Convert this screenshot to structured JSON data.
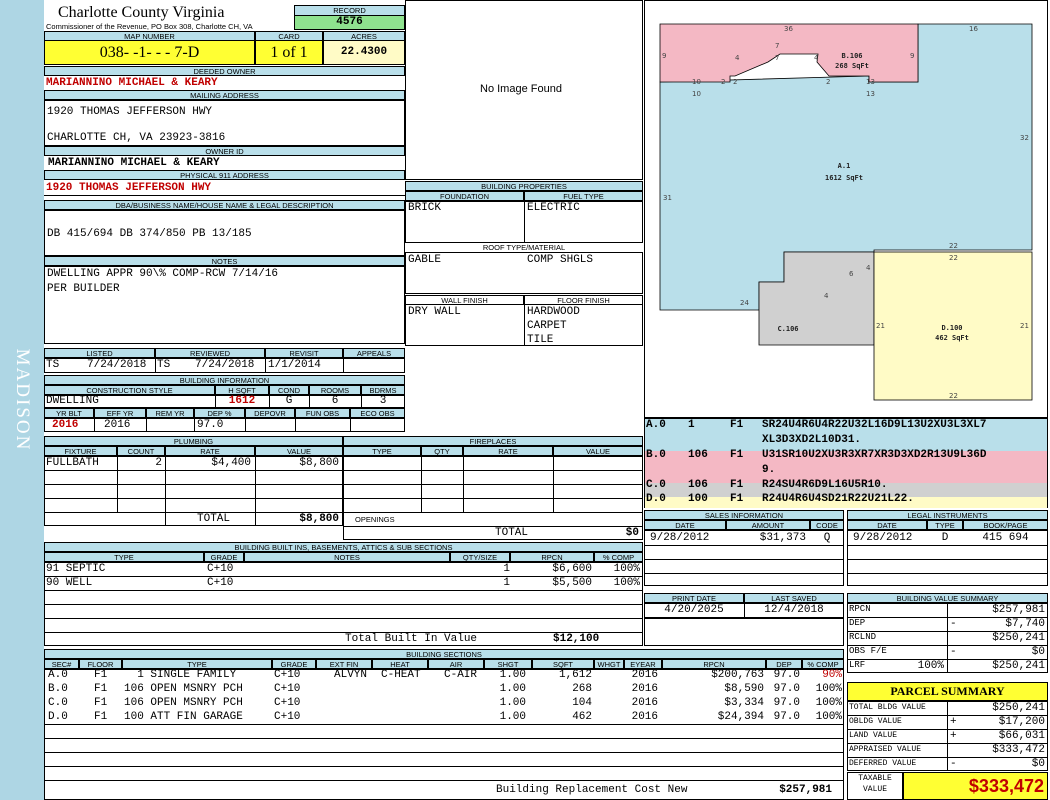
{
  "side_label": "MADISON",
  "header": {
    "county": "Charlotte County Virginia",
    "commissioner": "Commissioner of the Revenue, PO Box 308, Charlotte CH, VA",
    "record_label": "RECORD",
    "record": "4576"
  },
  "parcel": {
    "map_number_label": "MAP NUMBER",
    "map_number": "038- -1- - - 7-D",
    "card_label": "CARD",
    "card": "1 of 1",
    "acres_label": "ACRES",
    "acres": "22.4300"
  },
  "owner": {
    "deeded_label": "DEEDED OWNER",
    "deeded": "MARIANNINO MICHAEL & KEARY",
    "mailing_label": "MAILING ADDRESS",
    "mailing1": "1920 THOMAS JEFFERSON HWY",
    "mailing2": "CHARLOTTE CH, VA 23923-3816",
    "owner_id_label": "OWNER ID",
    "owner_id": "MARIANNINO MICHAEL & KEARY",
    "physical_label": "PHYSICAL 911 ADDRESS",
    "physical": "1920 THOMAS JEFFERSON HWY"
  },
  "legal": {
    "label": "DBA/BUSINESS NAME/HOUSE NAME & LEGAL DESCRIPTION",
    "text": "DB 415/694 DB 374/850 PB 13/185"
  },
  "notes": {
    "label": "NOTES",
    "line1": "DWELLING APPR 90\\% COMP-RCW 7/14/16",
    "line2": "PER BUILDER"
  },
  "photo": {
    "text": "No Image Found"
  },
  "building_props": {
    "label": "BUILDING PROPERTIES",
    "foundation_label": "FOUNDATION",
    "foundation": "BRICK",
    "fuel_label": "FUEL TYPE",
    "fuel": "ELECTRIC",
    "roof_label": "ROOF TYPE/MATERIAL",
    "roof_type": "GABLE",
    "roof_material": "COMP SHGLS",
    "wall_label": "WALL FINISH",
    "wall": "DRY WALL",
    "floor_label": "FLOOR FINISH",
    "floor1": "HARDWOOD",
    "floor2": "CARPET",
    "floor3": "TILE"
  },
  "dates": {
    "listed_label": "LISTED",
    "listed_by": "TS",
    "listed": "7/24/2018",
    "reviewed_label": "REVIEWED",
    "reviewed_by": "TS",
    "reviewed": "7/24/2018",
    "revisit_label": "REVISIT",
    "revisit": "1/1/2014",
    "appeals_label": "APPEALS",
    "appeals": ""
  },
  "bldg_info": {
    "label": "BUILDING INFORMATION",
    "style_label": "CONSTRUCTION STYLE",
    "style": "DWELLING",
    "hsqft_label": "H SQFT",
    "hsqft": "1612",
    "cond_label": "COND",
    "cond": "G",
    "rooms_label": "ROOMS",
    "rooms": "6",
    "bdrms_label": "BDRMS",
    "bdrms": "3",
    "yrblt_label": "YR BLT",
    "yrblt": "2016",
    "effyr_label": "EFF YR",
    "effyr": "2016",
    "remyr_label": "REM YR",
    "remyr": "",
    "dep_label": "DEP %",
    "dep": "97.0",
    "depovr_label": "DEPOVR",
    "funobs_label": "FUN OBS",
    "ecoobs_label": "ECO OBS"
  },
  "plumbing": {
    "label": "PLUMBING",
    "cols": [
      "FIXTURE",
      "COUNT",
      "RATE",
      "VALUE"
    ],
    "rows": [
      {
        "fixture": "FULLBATH",
        "count": "2",
        "rate": "$4,400",
        "value": "$8,800"
      }
    ],
    "total_label": "TOTAL",
    "total": "$8,800"
  },
  "fireplaces": {
    "label": "FIREPLACES",
    "cols": [
      "TYPE",
      "QTY",
      "RATE",
      "VALUE"
    ],
    "openings_label": "OPENINGS",
    "total_label": "TOTAL",
    "total": "$0"
  },
  "builtins": {
    "label": "BUILDING BUILT INS, BASEMENTS, ATTICS & SUB SECTIONS",
    "cols": [
      "TYPE",
      "GRADE",
      "NOTES",
      "QTY/SIZE",
      "RPCN",
      "% COMP"
    ],
    "rows": [
      {
        "type": "91 SEPTIC",
        "grade": "C+10",
        "qty": "1",
        "rpcn": "$6,600",
        "comp": "100%"
      },
      {
        "type": "90 WELL",
        "grade": "C+10",
        "qty": "1",
        "rpcn": "$5,500",
        "comp": "100%"
      }
    ],
    "total_label": "Total Built In Value",
    "total": "$12,100"
  },
  "sketch": {
    "labels": {
      "top36": "36",
      "top16": "16",
      "l9a": "9",
      "r9a": "9",
      "l31": "31",
      "r32": "32",
      "s10a": "10",
      "s10b": "10",
      "s13a": "13",
      "s13b": "13",
      "s7a": "7",
      "s7b": "7",
      "s4a": "4",
      "s4b": "4",
      "s2a": "2",
      "s2b": "2",
      "s2c": "2",
      "s22a": "22",
      "s22b": "22",
      "s22c": "22",
      "s4c": "4",
      "s6": "6",
      "s4d": "4",
      "s24": "24",
      "s21a": "21",
      "s21b": "21"
    },
    "areas": {
      "b_name": "B.106",
      "b_sqft": "268 SqFt",
      "a_name": "A.1",
      "a_sqft": "1612 SqFt",
      "c_name": "C.106",
      "d_name": "D.100",
      "d_sqft": "462 SqFt"
    }
  },
  "vectors": [
    {
      "id": "A.0",
      "code": "1",
      "fl": "F1",
      "v": "SR24U4R6U4R22U32L16D9L13U2XU3L3XL7",
      "v2": "XL3D3XD2L10D31.",
      "bg": "#b9dfea"
    },
    {
      "id": "B.0",
      "code": "106",
      "fl": "F1",
      "v": "U31SR10U2XU3R3XR7XR3D3XD2R13U9L36D",
      "v2": "9.",
      "bg": "#f4b8c4"
    },
    {
      "id": "C.0",
      "code": "106",
      "fl": "F1",
      "v": "R24SU4R6D9L16U5R10.",
      "v2": "",
      "bg": "#d0d0d0"
    },
    {
      "id": "D.0",
      "code": "100",
      "fl": "F1",
      "v": "R24U4R6U4SD21R22U21L22.",
      "v2": "",
      "bg": "#fffbc6"
    }
  ],
  "sales": {
    "label": "SALES INFORMATION",
    "cols": [
      "DATE",
      "AMOUNT",
      "CODE"
    ],
    "date": "9/28/2012",
    "amount": "$31,373",
    "code": "Q"
  },
  "legal_instruments": {
    "label": "LEGAL INSTRUMENTS",
    "cols": [
      "DATE",
      "TYPE",
      "BOOK/PAGE"
    ],
    "date": "9/28/2012",
    "type": "D",
    "bookpage": "415 694"
  },
  "print": {
    "print_label": "PRINT DATE",
    "print_date": "4/20/2025",
    "saved_label": "LAST SAVED",
    "saved": "12/4/2018"
  },
  "value_summary": {
    "label": "BUILDING VALUE SUMMARY",
    "rpcn_l": "RPCN",
    "rpcn": "$257,981",
    "dep_l": "DEP",
    "dep_s": "-",
    "dep": "$7,740",
    "rclnd_l": "RCLND",
    "rclnd": "$250,241",
    "obs_l": "OBS F/E",
    "obs_s": "-",
    "obs": "$0",
    "lrf_l": "LRF",
    "lrf_pct": "100%",
    "lrf": "$250,241"
  },
  "parcel_summary": {
    "label": "PARCEL SUMMARY",
    "tb_l": "TOTAL BLDG VALUE",
    "tb": "$250,241",
    "ob_l": "OBLDG VALUE",
    "ob_s": "+",
    "ob": "$17,200",
    "land_l": "LAND VALUE",
    "land_s": "+",
    "land": "$66,031",
    "appr_l": "APPRAISED VALUE",
    "appr": "$333,472",
    "def_l": "DEFERRED VALUE",
    "def_s": "-",
    "def": "$0",
    "tax_l1": "TAXABLE",
    "tax_l2": "VALUE",
    "tax": "$333,472"
  },
  "sections": {
    "label": "BUILDING SECTIONS",
    "cols": [
      "SEC#",
      "FLOOR",
      "TYPE",
      "GRADE",
      "EXT FIN",
      "HEAT",
      "AIR",
      "SHGT",
      "SQFT",
      "WHGT",
      "EYEAR",
      "RPCN",
      "DEP",
      "% COMP"
    ],
    "rows": [
      {
        "sec": "A.0",
        "fl": "F1",
        "type": "  1 SINGLE FAMILY",
        "grade": "C+10",
        "ext": "ALVYN",
        "heat": "C-HEAT",
        "air": "C-AIR",
        "shgt": "1.00",
        "sqft": "1,612",
        "eyear": "2016",
        "rpcn": "$200,763",
        "dep": "97.0",
        "comp": "90%"
      },
      {
        "sec": "B.0",
        "fl": "F1",
        "type": "106 OPEN MSNRY PCH",
        "grade": "C+10",
        "ext": "",
        "heat": "",
        "air": "",
        "shgt": "1.00",
        "sqft": "268",
        "eyear": "2016",
        "rpcn": "$8,590",
        "dep": "97.0",
        "comp": "100%"
      },
      {
        "sec": "C.0",
        "fl": "F1",
        "type": "106 OPEN MSNRY PCH",
        "grade": "C+10",
        "ext": "",
        "heat": "",
        "air": "",
        "shgt": "1.00",
        "sqft": "104",
        "eyear": "2016",
        "rpcn": "$3,334",
        "dep": "97.0",
        "comp": "100%"
      },
      {
        "sec": "D.0",
        "fl": "F1",
        "type": "100 ATT FIN GARAGE",
        "grade": "C+10",
        "ext": "",
        "heat": "",
        "air": "",
        "shgt": "1.00",
        "sqft": "462",
        "eyear": "2016",
        "rpcn": "$24,394",
        "dep": "97.0",
        "comp": "100%"
      }
    ],
    "total_label": "Building Replacement Cost New",
    "total": "$257,981"
  }
}
